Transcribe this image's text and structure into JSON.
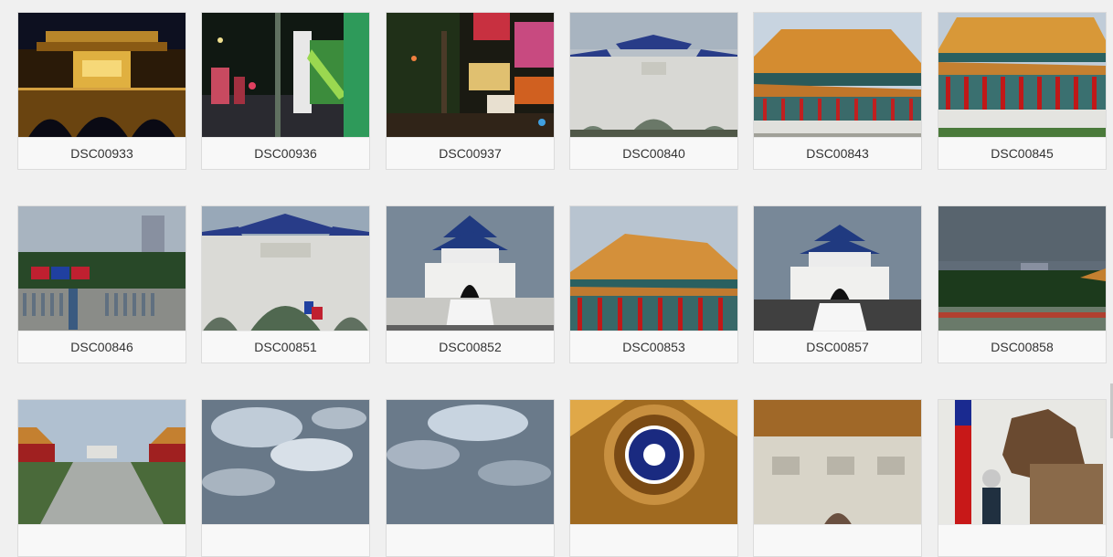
{
  "gallery": {
    "photos": [
      {
        "caption": "DSC00933"
      },
      {
        "caption": "DSC00936"
      },
      {
        "caption": "DSC00937"
      },
      {
        "caption": "DSC00840"
      },
      {
        "caption": "DSC00843"
      },
      {
        "caption": "DSC00845"
      },
      {
        "caption": "DSC00846"
      },
      {
        "caption": "DSC00851"
      },
      {
        "caption": "DSC00852"
      },
      {
        "caption": "DSC00853"
      },
      {
        "caption": "DSC00857"
      },
      {
        "caption": "DSC00858"
      },
      {
        "caption": ""
      },
      {
        "caption": ""
      },
      {
        "caption": ""
      },
      {
        "caption": ""
      },
      {
        "caption": ""
      },
      {
        "caption": ""
      }
    ]
  },
  "colors": {
    "page_background": "#f0f0f0",
    "caption_background": "#f8f8f8",
    "caption_text": "#333333",
    "card_border": "#dcdcdc"
  }
}
